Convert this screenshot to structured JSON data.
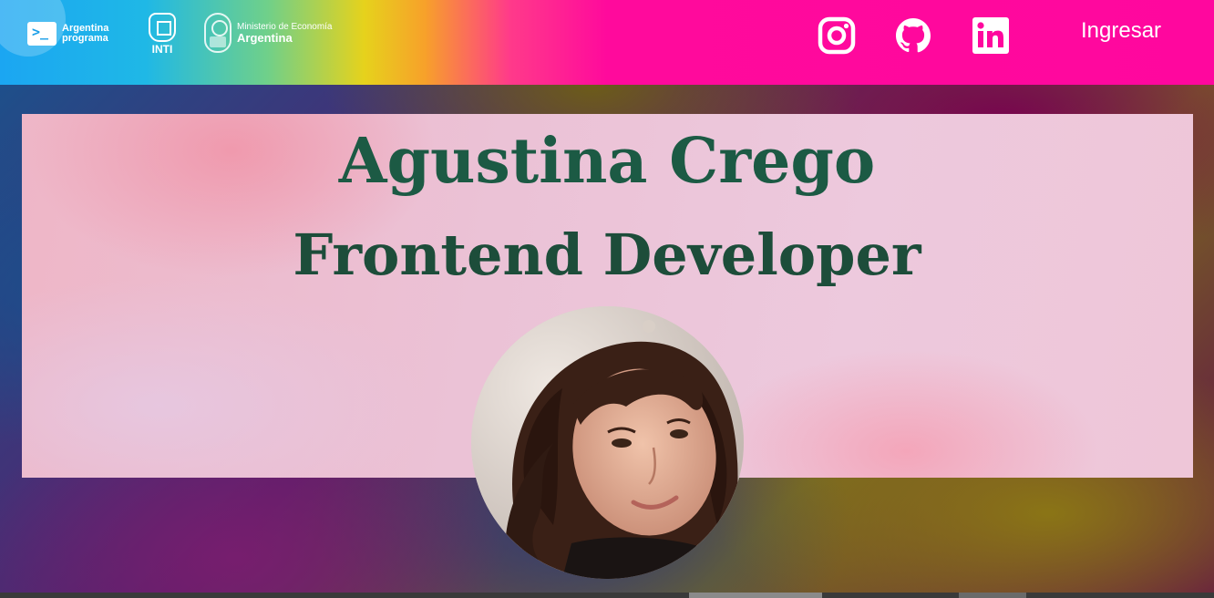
{
  "header": {
    "brand_logo": {
      "line1": "Argentina",
      "line2": "programa",
      "icon": "terminal-icon"
    },
    "inti_logo": {
      "label": "INTI"
    },
    "ministry_logo": {
      "line1": "Ministerio de Economía",
      "line2": "Argentina"
    },
    "social": [
      {
        "name": "instagram",
        "icon": "instagram-icon"
      },
      {
        "name": "github",
        "icon": "github-icon"
      },
      {
        "name": "linkedin",
        "icon": "linkedin-icon"
      }
    ],
    "login_label": "Ingresar"
  },
  "hero": {
    "name": "Agustina Crego",
    "role": "Frontend Developer",
    "avatar": "profile-photo"
  },
  "colors": {
    "header_gradient_start": "#1ba6f2",
    "header_gradient_end": "#ff079e",
    "title_color": "#1c5a44"
  }
}
